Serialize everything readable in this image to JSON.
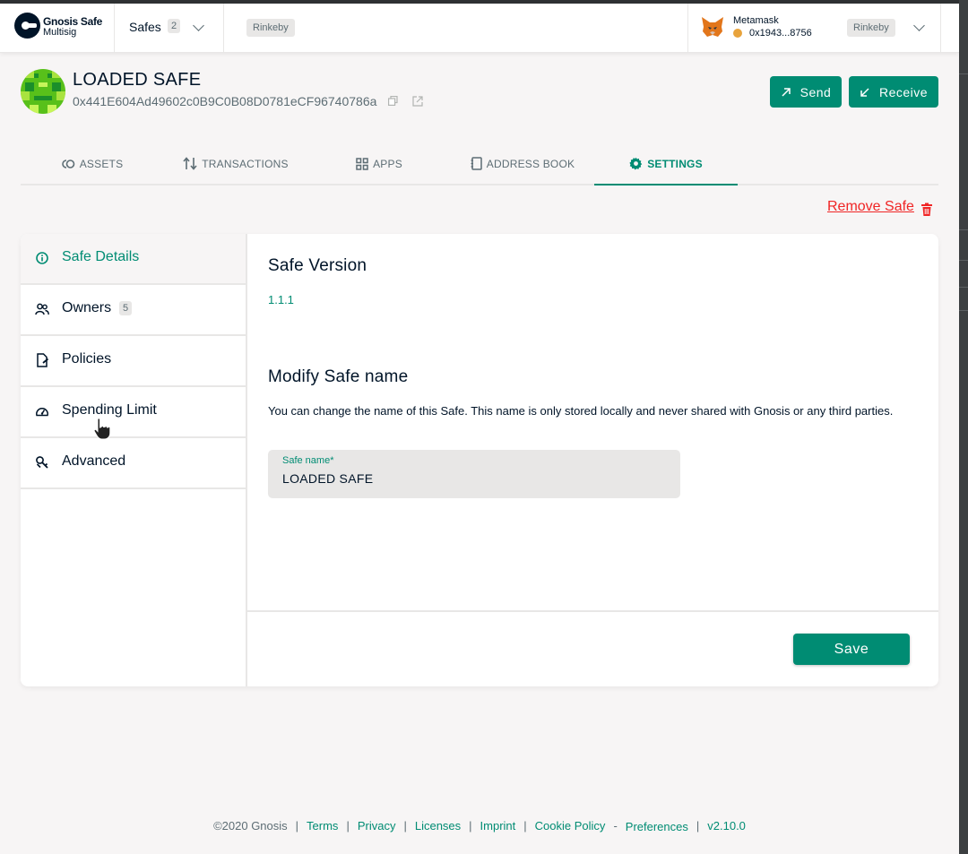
{
  "app": {
    "logo_line1": "Gnosis Safe",
    "logo_line2": "Multisig"
  },
  "header": {
    "safes_label": "Safes",
    "safes_count": "2",
    "network": "Rinkeby",
    "wallet": {
      "provider": "Metamask",
      "address": "0x1943...8756",
      "network": "Rinkeby"
    }
  },
  "safe": {
    "name": "LOADED SAFE",
    "address": "0x441E604Ad49602c0B9C0B08D0781eCF96740786a"
  },
  "actions": {
    "send": "Send",
    "receive": "Receive"
  },
  "tabs": [
    {
      "label": "ASSETS",
      "icon": "assets-icon"
    },
    {
      "label": "TRANSACTIONS",
      "icon": "transactions-icon"
    },
    {
      "label": "APPS",
      "icon": "apps-icon"
    },
    {
      "label": "ADDRESS BOOK",
      "icon": "address-book-icon"
    },
    {
      "label": "SETTINGS",
      "icon": "settings-icon",
      "active": true
    }
  ],
  "remove_safe": "Remove Safe",
  "settings_nav": [
    {
      "label": "Safe Details",
      "icon": "info-icon",
      "active": true
    },
    {
      "label": "Owners",
      "icon": "owners-icon",
      "badge": "5"
    },
    {
      "label": "Policies",
      "icon": "policies-icon"
    },
    {
      "label": "Spending Limit",
      "icon": "spending-limit-icon"
    },
    {
      "label": "Advanced",
      "icon": "advanced-icon"
    }
  ],
  "details": {
    "version_title": "Safe Version",
    "version": "1.1.1",
    "modify_title": "Modify Safe name",
    "description": "You can change the name of this Safe. This name is only stored locally and never shared with Gnosis or any third parties.",
    "field_label": "Safe name*",
    "field_value": "LOADED SAFE",
    "save": "Save"
  },
  "footer": {
    "copyright": "©2020 Gnosis",
    "terms": "Terms",
    "privacy": "Privacy",
    "licenses": "Licenses",
    "imprint": "Imprint",
    "cookie_policy": "Cookie Policy",
    "preferences": "Preferences",
    "version": "v2.10.0"
  },
  "colors": {
    "primary": "#008c73",
    "danger": "#f02525",
    "text": "#001428",
    "muted": "#5d6d74",
    "background": "#f7f5f5"
  }
}
